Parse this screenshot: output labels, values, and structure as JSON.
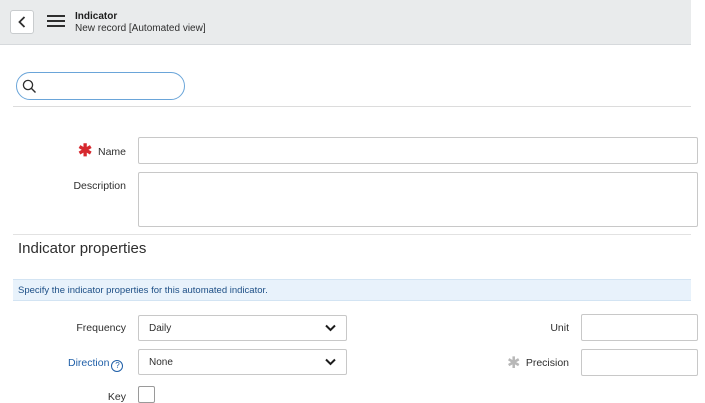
{
  "header": {
    "title": "Indicator",
    "subtitle": "New record [Automated view]"
  },
  "search": {
    "value": "",
    "placeholder": ""
  },
  "form": {
    "name": {
      "label": "Name",
      "required_marker": "✱",
      "value": ""
    },
    "description": {
      "label": "Description",
      "value": ""
    }
  },
  "section": {
    "title": "Indicator properties",
    "info_message": "Specify the indicator properties for this automated indicator."
  },
  "properties": {
    "frequency": {
      "label": "Frequency",
      "value": "Daily"
    },
    "direction": {
      "label": "Direction",
      "help_glyph": "?",
      "value": "None"
    },
    "key": {
      "label": "Key",
      "checked": false
    },
    "unit": {
      "label": "Unit",
      "value": ""
    },
    "precision": {
      "label": "Precision",
      "marker": "✱",
      "value": ""
    }
  },
  "colors": {
    "header_bg": "#e9ebec",
    "required_star": "#d6282e",
    "link": "#1f5fa8",
    "info_bg": "#e8f2fb",
    "search_border": "#6aa5d9"
  }
}
